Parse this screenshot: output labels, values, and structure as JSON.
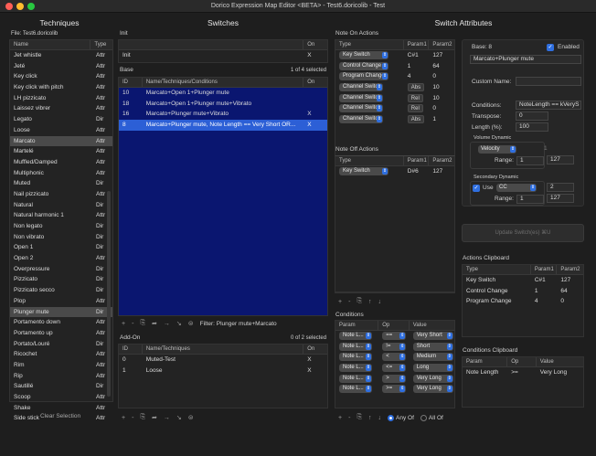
{
  "window": {
    "title": "Dorico Expression Map Editor <BETA> - Test6.doricolib - Test"
  },
  "techniques": {
    "title": "Techniques",
    "file_label": "File: Test6.doricolib",
    "col_name": "Name",
    "col_type": "Type",
    "items": [
      {
        "name": "Jet whistle",
        "type": "Attr"
      },
      {
        "name": "Jeté",
        "type": "Attr"
      },
      {
        "name": "Key click",
        "type": "Attr"
      },
      {
        "name": "Key click with pitch",
        "type": "Attr"
      },
      {
        "name": "LH pizzicato",
        "type": "Attr"
      },
      {
        "name": "Laissez vibrer",
        "type": "Attr"
      },
      {
        "name": "Legato",
        "type": "Dir"
      },
      {
        "name": "Loose",
        "type": "Attr"
      },
      {
        "name": "Marcato",
        "type": "Attr"
      },
      {
        "name": "Martelé",
        "type": "Attr"
      },
      {
        "name": "Muffled/Damped",
        "type": "Attr"
      },
      {
        "name": "Multiphonic",
        "type": "Attr"
      },
      {
        "name": "Muted",
        "type": "Dir"
      },
      {
        "name": "Nail pizzicato",
        "type": "Attr"
      },
      {
        "name": "Natural",
        "type": "Dir"
      },
      {
        "name": "Natural harmonic 1",
        "type": "Attr"
      },
      {
        "name": "Non legato",
        "type": "Dir"
      },
      {
        "name": "Non vibrato",
        "type": "Dir"
      },
      {
        "name": "Open 1",
        "type": "Dir"
      },
      {
        "name": "Open 2",
        "type": "Attr"
      },
      {
        "name": "Overpressure",
        "type": "Dir"
      },
      {
        "name": "Pizzicato",
        "type": "Dir"
      },
      {
        "name": "Pizzicato secco",
        "type": "Dir"
      },
      {
        "name": "Plop",
        "type": "Attr"
      },
      {
        "name": "Plunger mute",
        "type": "Dir"
      },
      {
        "name": "Portamento down",
        "type": "Attr"
      },
      {
        "name": "Portamento up",
        "type": "Attr"
      },
      {
        "name": "Portato/Louré",
        "type": "Dir"
      },
      {
        "name": "Ricochet",
        "type": "Attr"
      },
      {
        "name": "Rim",
        "type": "Attr"
      },
      {
        "name": "Rip",
        "type": "Attr"
      },
      {
        "name": "Sautillé",
        "type": "Dir"
      },
      {
        "name": "Scoop",
        "type": "Attr"
      },
      {
        "name": "Shake",
        "type": "Attr"
      },
      {
        "name": "Side stick",
        "type": "Attr"
      }
    ],
    "selected_gray": [
      8,
      24
    ],
    "clear_selection": "Clear Selection"
  },
  "switches": {
    "title": "Switches",
    "init_label": "Init",
    "col_on": "On",
    "init_row": {
      "name": "Init",
      "on": "X"
    },
    "base_label": "Base",
    "base_count": "1 of 4 selected",
    "col_id": "ID",
    "col_name": "Name/Techniques/Conditions",
    "base_rows": [
      {
        "id": "10",
        "name": "Marcato+Open 1+Plunger mute",
        "on": ""
      },
      {
        "id": "18",
        "name": "Marcato+Open 1+Plunger mute+Vibrato",
        "on": ""
      },
      {
        "id": "16",
        "name": "Marcato+Plunger mute+Vibrato",
        "on": "X"
      },
      {
        "id": "8",
        "name": "Marcato+Plunger mute, Note Length == Very Short OR...",
        "on": "X"
      }
    ],
    "filter_text": "Filter: Plunger mute+Marcato",
    "addon_label": "Add-On",
    "addon_count": "0 of 2 selected",
    "col_name_tech": "Name/Techniques",
    "addon_rows": [
      {
        "id": "0",
        "name": "Muted-Test",
        "on": "X"
      },
      {
        "id": "1",
        "name": "Loose",
        "on": "X"
      }
    ]
  },
  "note_on": {
    "title": "Note On Actions",
    "col_type": "Type",
    "col_p1": "Param1",
    "col_p2": "Param2",
    "rows": [
      {
        "type": "Key Switch",
        "mode": "",
        "p1": "C#1",
        "p2": "127"
      },
      {
        "type": "Control Change",
        "mode": "",
        "p1": "1",
        "p2": "64"
      },
      {
        "type": "Program Change",
        "mode": "",
        "p1": "4",
        "p2": "0"
      },
      {
        "type": "Channel Switch",
        "mode": "Abs",
        "p1": "",
        "p2": "10"
      },
      {
        "type": "Channel Switch",
        "mode": "Rel",
        "p1": "",
        "p2": "10"
      },
      {
        "type": "Channel Switch",
        "mode": "Rel",
        "p1": "",
        "p2": "0"
      },
      {
        "type": "Channel Switch",
        "mode": "Abs",
        "p1": "",
        "p2": "1"
      }
    ]
  },
  "note_off": {
    "title": "Note Off Actions",
    "rows": [
      {
        "type": "Key Switch",
        "p1": "D#6",
        "p2": "127"
      }
    ]
  },
  "conditions": {
    "title": "Conditions",
    "col_param": "Param",
    "col_op": "Op",
    "col_value": "Value",
    "rows": [
      {
        "param": "Note L...",
        "op": "==",
        "value": "Very Short"
      },
      {
        "param": "Note L...",
        "op": "!=",
        "value": "Short"
      },
      {
        "param": "Note L...",
        "op": "<",
        "value": "Medium"
      },
      {
        "param": "Note L...",
        "op": "<=",
        "value": "Long"
      },
      {
        "param": "Note L...",
        "op": ">",
        "value": "Very Long"
      },
      {
        "param": "Note L...",
        "op": ">=",
        "value": "Very Long"
      }
    ],
    "any_of": "Any Of",
    "all_of": "All Of"
  },
  "attributes": {
    "title": "Switch Attributes",
    "base_label": "Base: 8",
    "enabled_label": "Enabled",
    "name_value": "Marcato+Plunger mute",
    "custom_name_label": "Custom Name:",
    "conditions_label": "Conditions:",
    "conditions_value": "NoteLength == kVeryS",
    "transpose_label": "Transpose:",
    "transpose_value": "0",
    "length_label": "Length (%):",
    "length_value": "100",
    "volume_dynamic_label": "Volume Dynamic",
    "velocity": "Velocity",
    "velocity_val": "1",
    "range_label": "Range:",
    "vol_range_lo": "1",
    "vol_range_hi": "127",
    "secondary_dynamic_label": "Secondary Dynamic",
    "use_label": "Use",
    "cc_label": "CC",
    "cc_value": "2",
    "sec_range_lo": "1",
    "sec_range_hi": "127",
    "update_button": "Update Switch(es) ⌘U"
  },
  "actions_clipboard": {
    "title": "Actions Clipboard",
    "col_type": "Type",
    "col_p1": "Param1",
    "col_p2": "Param2",
    "rows": [
      {
        "type": "Key Switch",
        "p1": "C#1",
        "p2": "127"
      },
      {
        "type": "Control Change",
        "p1": "1",
        "p2": "64"
      },
      {
        "type": "Program Change",
        "p1": "4",
        "p2": "0"
      }
    ]
  },
  "conditions_clipboard": {
    "title": "Conditions Clipboard",
    "col_param": "Param",
    "col_op": "Op",
    "col_value": "Value",
    "rows": [
      {
        "param": "Note Length",
        "op": ">=",
        "value": "Very Long"
      }
    ]
  }
}
